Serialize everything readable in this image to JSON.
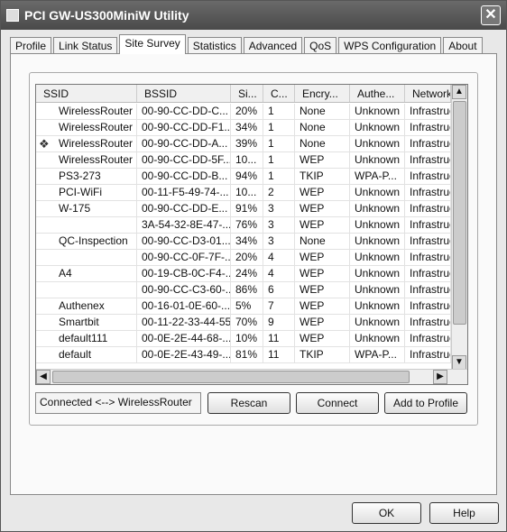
{
  "window": {
    "title": "PCI GW-US300MiniW Utility",
    "close": "✕"
  },
  "tabs": [
    {
      "label": "Profile"
    },
    {
      "label": "Link Status"
    },
    {
      "label": "Site Survey",
      "active": true
    },
    {
      "label": "Statistics"
    },
    {
      "label": "Advanced"
    },
    {
      "label": "QoS"
    },
    {
      "label": "WPS Configuration"
    },
    {
      "label": "About"
    }
  ],
  "table": {
    "columns": [
      "SSID",
      "BSSID",
      "Si...",
      "C...",
      "Encry...",
      "Authe...",
      "Network"
    ],
    "rows": [
      [
        "WirelessRouter",
        "00-90-CC-DD-C...",
        "20%",
        "1",
        "None",
        "Unknown",
        "Infrastruc"
      ],
      [
        "WirelessRouter",
        "00-90-CC-DD-F1...",
        "34%",
        "1",
        "None",
        "Unknown",
        "Infrastruc"
      ],
      [
        "WirelessRouter",
        "00-90-CC-DD-A...",
        "39%",
        "1",
        "None",
        "Unknown",
        "Infrastruc"
      ],
      [
        "WirelessRouter",
        "00-90-CC-DD-5F...",
        "10...",
        "1",
        "WEP",
        "Unknown",
        "Infrastruc"
      ],
      [
        "PS3-273",
        "00-90-CC-DD-B...",
        "94%",
        "1",
        "TKIP",
        "WPA-P...",
        "Infrastruc"
      ],
      [
        "PCI-WiFi",
        "00-11-F5-49-74-...",
        "10...",
        "2",
        "WEP",
        "Unknown",
        "Infrastruc"
      ],
      [
        "W-175",
        "00-90-CC-DD-E...",
        "91%",
        "3",
        "WEP",
        "Unknown",
        "Infrastruc"
      ],
      [
        "",
        "3A-54-32-8E-47-...",
        "76%",
        "3",
        "WEP",
        "Unknown",
        "Infrastruc"
      ],
      [
        "QC-Inspection",
        "00-90-CC-D3-01...",
        "34%",
        "3",
        "None",
        "Unknown",
        "Infrastruc"
      ],
      [
        "",
        "00-90-CC-0F-7F-...",
        "20%",
        "4",
        "WEP",
        "Unknown",
        "Infrastruc"
      ],
      [
        "A4",
        "00-19-CB-0C-F4-...",
        "24%",
        "4",
        "WEP",
        "Unknown",
        "Infrastruc"
      ],
      [
        "",
        "00-90-CC-C3-60-...",
        "86%",
        "6",
        "WEP",
        "Unknown",
        "Infrastruc"
      ],
      [
        "Authenex",
        "00-16-01-0E-60-...",
        "5%",
        "7",
        "WEP",
        "Unknown",
        "Infrastruc"
      ],
      [
        "Smartbit",
        "00-11-22-33-44-55",
        "70%",
        "9",
        "WEP",
        "Unknown",
        "Infrastruc"
      ],
      [
        "default111",
        "00-0E-2E-44-68-...",
        "10%",
        "11",
        "WEP",
        "Unknown",
        "Infrastruc"
      ],
      [
        "default",
        "00-0E-2E-43-49-...",
        "81%",
        "11",
        "TKIP",
        "WPA-P...",
        "Infrastruc"
      ]
    ],
    "connected_row": 2,
    "connected_icon": "wireless-connected-icon"
  },
  "status": "Connected <--> WirelessRouter",
  "buttons": {
    "rescan": "Rescan",
    "connect": "Connect",
    "add": "Add to Profile",
    "ok": "OK",
    "help": "Help"
  }
}
